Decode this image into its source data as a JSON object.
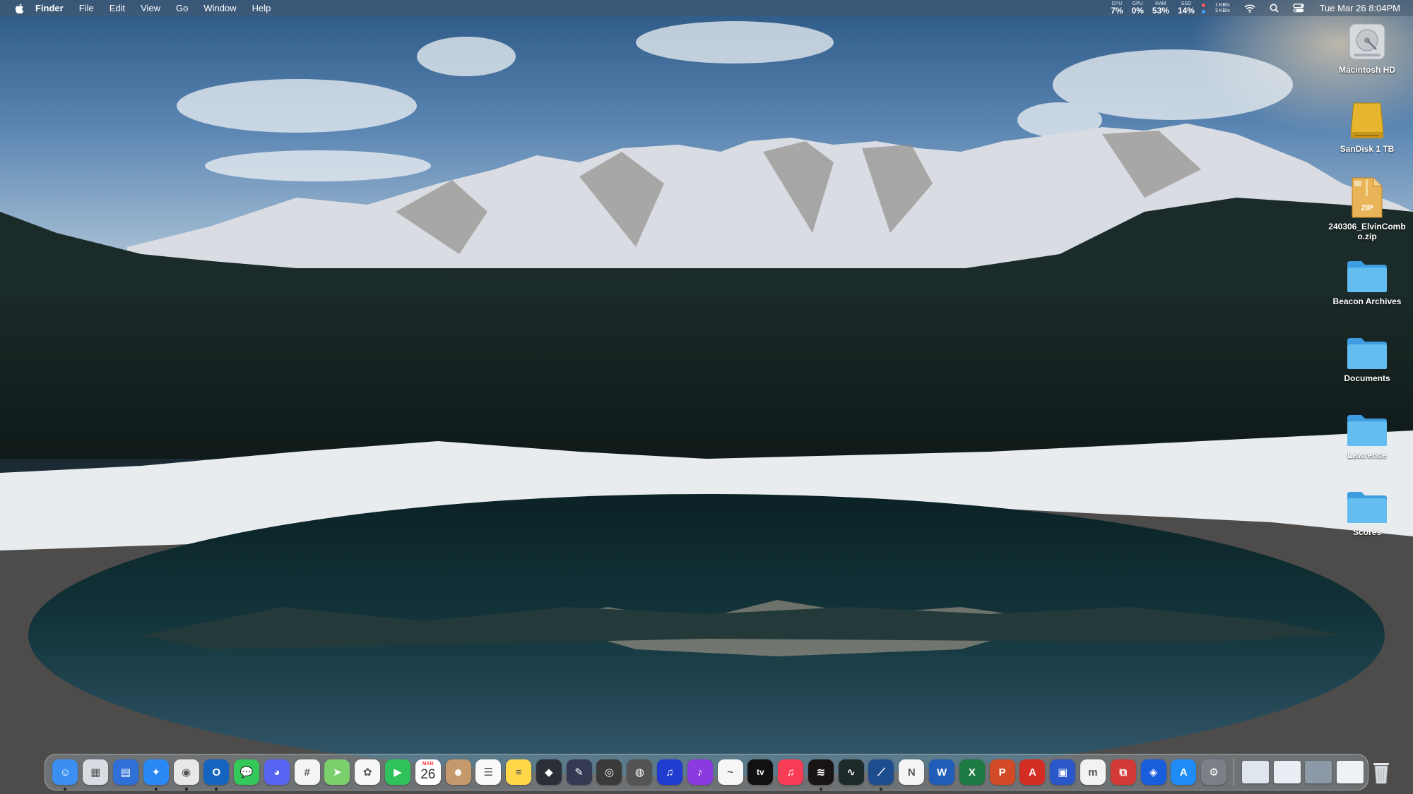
{
  "menubar": {
    "app_name": "Finder",
    "menus": [
      "File",
      "Edit",
      "View",
      "Go",
      "Window",
      "Help"
    ],
    "stats": [
      {
        "label": "CPU",
        "value": "7%"
      },
      {
        "label": "GPU",
        "value": "0%"
      },
      {
        "label": "RAM",
        "value": "53%"
      },
      {
        "label": "SSD",
        "value": "14%"
      }
    ],
    "net_up": "1 KB/s",
    "net_down": "3 KB/s",
    "datetime": "Tue Mar 26  8:04PM"
  },
  "desktop": {
    "items": [
      {
        "label": "Macintosh HD",
        "icon": "hard-drive-icon"
      },
      {
        "label": "SanDisk 1 TB",
        "icon": "external-drive-icon"
      },
      {
        "label": "240306_ElvinCombo.zip",
        "icon": "zip-archive-icon",
        "badge": "ZIP"
      },
      {
        "label": "Beacon Archives",
        "icon": "folder-icon"
      },
      {
        "label": "Documents",
        "icon": "folder-icon"
      },
      {
        "label": "Lawrence",
        "icon": "folder-icon"
      },
      {
        "label": "Scores",
        "icon": "folder-icon"
      }
    ]
  },
  "dock": {
    "calendar": {
      "month": "MAR",
      "day": "26"
    },
    "apps": [
      {
        "name": "finder",
        "color": "#3a8ff0",
        "glyph": "☺",
        "running": true
      },
      {
        "name": "launchpad",
        "color": "#d8dde4",
        "glyph": "▦",
        "running": false
      },
      {
        "name": "files",
        "color": "#2f6fd8",
        "glyph": "▤",
        "running": false
      },
      {
        "name": "safari",
        "color": "#2a88f5",
        "glyph": "✦",
        "running": true
      },
      {
        "name": "chrome",
        "color": "#e8e8e8",
        "glyph": "◉",
        "running": true
      },
      {
        "name": "outlook",
        "color": "#1565c0",
        "glyph": "O",
        "running": true
      },
      {
        "name": "messages",
        "color": "#34c759",
        "glyph": "💬",
        "running": false
      },
      {
        "name": "discord",
        "color": "#5865f2",
        "glyph": "◕",
        "running": false
      },
      {
        "name": "slack",
        "color": "#f4f4f4",
        "glyph": "#",
        "running": false
      },
      {
        "name": "maps",
        "color": "#7ccf6d",
        "glyph": "➤",
        "running": false
      },
      {
        "name": "photos",
        "color": "#f8f8f8",
        "glyph": "✿",
        "running": false
      },
      {
        "name": "facetime",
        "color": "#30c25a",
        "glyph": "▶",
        "running": false
      },
      {
        "name": "calendar",
        "color": "#ffffff",
        "glyph": "",
        "running": false
      },
      {
        "name": "contacts",
        "color": "#c49a6c",
        "glyph": "☻",
        "running": false
      },
      {
        "name": "reminders",
        "color": "#fafafa",
        "glyph": "☰",
        "running": false
      },
      {
        "name": "notes",
        "color": "#ffd84a",
        "glyph": "≡",
        "running": false
      },
      {
        "name": "davinci",
        "color": "#2b2f38",
        "glyph": "◆",
        "running": false
      },
      {
        "name": "xcode-like",
        "color": "#333a52",
        "glyph": "✎",
        "running": false
      },
      {
        "name": "camera",
        "color": "#3a3a3a",
        "glyph": "◎",
        "running": false
      },
      {
        "name": "disk-utility",
        "color": "#545454",
        "glyph": "◍",
        "running": false
      },
      {
        "name": "audiobooks",
        "color": "#1f3bd0",
        "glyph": "♫",
        "running": false
      },
      {
        "name": "podcasts-like",
        "color": "#8a3be0",
        "glyph": "♪",
        "running": false
      },
      {
        "name": "freeform",
        "color": "#f6f6f6",
        "glyph": "~",
        "running": false
      },
      {
        "name": "apple-tv",
        "color": "#111111",
        "glyph": "tv",
        "running": false
      },
      {
        "name": "music",
        "color": "#f93c55",
        "glyph": "♫",
        "running": false
      },
      {
        "name": "spotify",
        "color": "#191414",
        "glyph": "≋",
        "running": true
      },
      {
        "name": "activity-monitor",
        "color": "#1e2a2a",
        "glyph": "∿",
        "running": false
      },
      {
        "name": "stocks",
        "color": "#1d4c8f",
        "glyph": "⟋",
        "running": true
      },
      {
        "name": "news",
        "color": "#f4f4f4",
        "glyph": "N",
        "running": false
      },
      {
        "name": "word",
        "color": "#1f5db8",
        "glyph": "W",
        "running": false
      },
      {
        "name": "excel",
        "color": "#1d7a43",
        "glyph": "X",
        "running": false
      },
      {
        "name": "powerpoint",
        "color": "#d24a26",
        "glyph": "P",
        "running": false
      },
      {
        "name": "acrobat",
        "color": "#d42d24",
        "glyph": "A",
        "running": false
      },
      {
        "name": "screens",
        "color": "#2a58c9",
        "glyph": "▣",
        "running": false
      },
      {
        "name": "mela",
        "color": "#f2f2f2",
        "glyph": "m",
        "running": false
      },
      {
        "name": "parallels",
        "color": "#d33a37",
        "glyph": "⧉",
        "running": false
      },
      {
        "name": "bitwarden",
        "color": "#175ddc",
        "glyph": "◈",
        "running": false
      },
      {
        "name": "app-store",
        "color": "#1f8cf5",
        "glyph": "A",
        "running": false
      },
      {
        "name": "system-settings",
        "color": "#7b7f86",
        "glyph": "⚙",
        "running": false
      }
    ],
    "stacks": [
      {
        "name": "stack-doc-1",
        "color": "#dfe6ee"
      },
      {
        "name": "stack-doc-2",
        "color": "#e9eef4"
      },
      {
        "name": "stack-screenshot",
        "color": "#8c9aa8"
      },
      {
        "name": "stack-doc-3",
        "color": "#eef2f6"
      }
    ]
  },
  "colors": {
    "folder_blue": "#5fb8ee",
    "sky_top": "#2d5886",
    "water": "#0f2a30"
  }
}
